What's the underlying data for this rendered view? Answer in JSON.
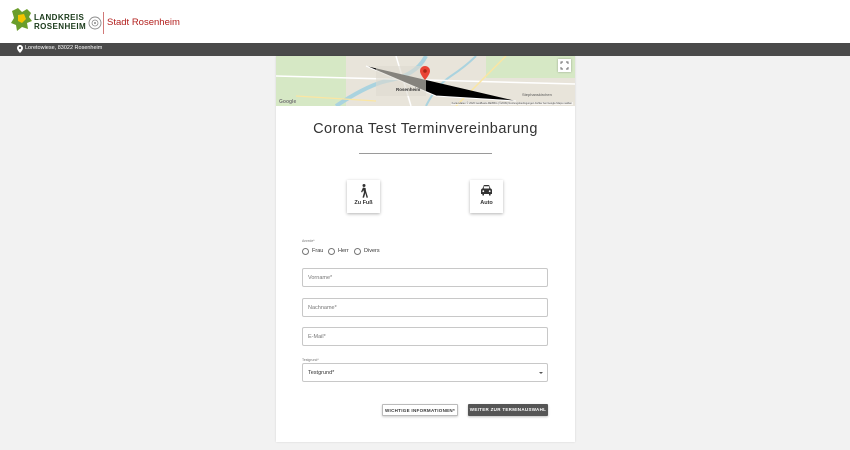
{
  "header": {
    "logo_landkreis": {
      "line1": "LANDKREIS",
      "line2": "ROSENHEIM"
    },
    "logo_stadt": "Stadt Rosenheim",
    "brand_green": "#6a9d2b",
    "brand_red": "#b3201e"
  },
  "location_bar": {
    "icon": "location-pin-icon",
    "text": "Loretowiese, 83022 Rosenheim"
  },
  "map": {
    "city_label": "Rosenheim",
    "district_label": "Stephanskirchen",
    "google_label": "Google",
    "attribution": "Kartendaten © 2020 GeoBasis-DE/BKG (©2009)   Nutzungsbedingungen   Fehler bei Google Maps melden",
    "fullscreen_icon": "fullscreen-icon",
    "marker_icon": "map-marker-icon"
  },
  "form": {
    "title": "Corona Test Terminvereinbarung",
    "modes": [
      {
        "label": "Zu Fuß",
        "icon": "walking-icon"
      },
      {
        "label": "Auto",
        "icon": "car-icon"
      }
    ],
    "anrede_label": "Anrede*",
    "anrede_options": [
      "Frau",
      "Herr",
      "Divers"
    ],
    "vorname_placeholder": "Vorname*",
    "nachname_placeholder": "Nachname*",
    "email_placeholder": "E-Mail*",
    "testgrund_label": "Testgrund*",
    "testgrund_value": "Testgrund*",
    "btn_info": "WICHTIGE INFORMATIONEN*",
    "btn_next": "WEITER ZUR TERMINAUSWAHL"
  }
}
